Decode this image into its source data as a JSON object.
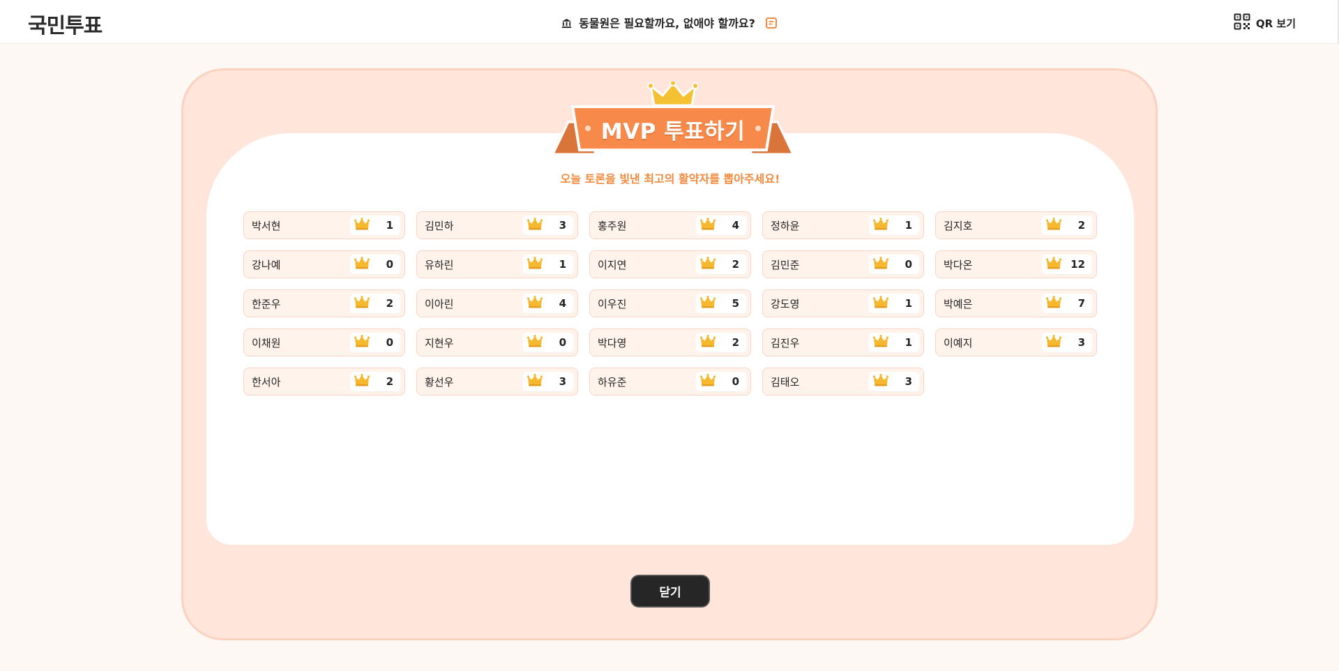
{
  "header": {
    "logo": "국민투표",
    "topic": "동물원은 필요할까요, 없애야 할까요?",
    "qr_label": "QR 보기"
  },
  "modal": {
    "title": "MVP 투표하기",
    "subtitle": "오늘 토론을 빛낸 최고의 활약자를 뽑아주세요!",
    "close_label": "닫기"
  },
  "candidates": [
    {
      "name": "박서현",
      "votes": "1"
    },
    {
      "name": "김민하",
      "votes": "3"
    },
    {
      "name": "홍주원",
      "votes": "4"
    },
    {
      "name": "정하윤",
      "votes": "1"
    },
    {
      "name": "김지호",
      "votes": "2"
    },
    {
      "name": "강나예",
      "votes": "0"
    },
    {
      "name": "유하린",
      "votes": "1"
    },
    {
      "name": "이지연",
      "votes": "2"
    },
    {
      "name": "김민준",
      "votes": "0"
    },
    {
      "name": "박다온",
      "votes": "12"
    },
    {
      "name": "한준우",
      "votes": "2"
    },
    {
      "name": "이아린",
      "votes": "4"
    },
    {
      "name": "이우진",
      "votes": "5"
    },
    {
      "name": "강도영",
      "votes": "1"
    },
    {
      "name": "박예은",
      "votes": "7"
    },
    {
      "name": "이채원",
      "votes": "0"
    },
    {
      "name": "지현우",
      "votes": "0"
    },
    {
      "name": "박다영",
      "votes": "2"
    },
    {
      "name": "김진우",
      "votes": "1"
    },
    {
      "name": "이예지",
      "votes": "3"
    },
    {
      "name": "한서아",
      "votes": "2"
    },
    {
      "name": "황선우",
      "votes": "3"
    },
    {
      "name": "하유준",
      "votes": "0"
    },
    {
      "name": "김태오",
      "votes": "3"
    }
  ],
  "colors": {
    "accent": "#f28a3d",
    "modal_bg": "#ffe5da",
    "card_bg": "#fff3ec",
    "crown": "#f5b82e",
    "close_button": "#262626"
  },
  "icons": {
    "vote": "crown-icon",
    "topic": "bank-icon",
    "memo": "memo-icon",
    "qr": "qr-code-icon"
  }
}
